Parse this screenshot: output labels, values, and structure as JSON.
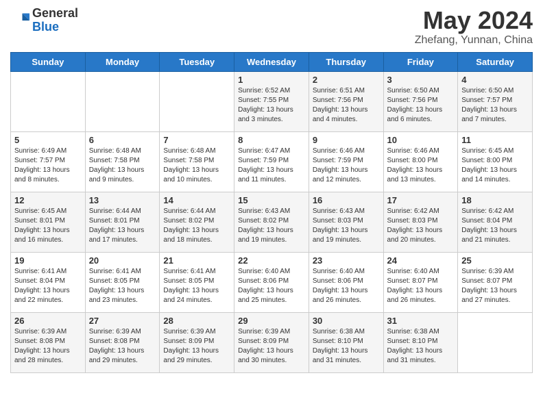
{
  "header": {
    "logo_general": "General",
    "logo_blue": "Blue",
    "title": "May 2024",
    "location": "Zhefang, Yunnan, China"
  },
  "days_of_week": [
    "Sunday",
    "Monday",
    "Tuesday",
    "Wednesday",
    "Thursday",
    "Friday",
    "Saturday"
  ],
  "weeks": [
    [
      {
        "day": "",
        "info": ""
      },
      {
        "day": "",
        "info": ""
      },
      {
        "day": "",
        "info": ""
      },
      {
        "day": "1",
        "info": "Sunrise: 6:52 AM\nSunset: 7:55 PM\nDaylight: 13 hours and 3 minutes."
      },
      {
        "day": "2",
        "info": "Sunrise: 6:51 AM\nSunset: 7:56 PM\nDaylight: 13 hours and 4 minutes."
      },
      {
        "day": "3",
        "info": "Sunrise: 6:50 AM\nSunset: 7:56 PM\nDaylight: 13 hours and 6 minutes."
      },
      {
        "day": "4",
        "info": "Sunrise: 6:50 AM\nSunset: 7:57 PM\nDaylight: 13 hours and 7 minutes."
      }
    ],
    [
      {
        "day": "5",
        "info": "Sunrise: 6:49 AM\nSunset: 7:57 PM\nDaylight: 13 hours and 8 minutes."
      },
      {
        "day": "6",
        "info": "Sunrise: 6:48 AM\nSunset: 7:58 PM\nDaylight: 13 hours and 9 minutes."
      },
      {
        "day": "7",
        "info": "Sunrise: 6:48 AM\nSunset: 7:58 PM\nDaylight: 13 hours and 10 minutes."
      },
      {
        "day": "8",
        "info": "Sunrise: 6:47 AM\nSunset: 7:59 PM\nDaylight: 13 hours and 11 minutes."
      },
      {
        "day": "9",
        "info": "Sunrise: 6:46 AM\nSunset: 7:59 PM\nDaylight: 13 hours and 12 minutes."
      },
      {
        "day": "10",
        "info": "Sunrise: 6:46 AM\nSunset: 8:00 PM\nDaylight: 13 hours and 13 minutes."
      },
      {
        "day": "11",
        "info": "Sunrise: 6:45 AM\nSunset: 8:00 PM\nDaylight: 13 hours and 14 minutes."
      }
    ],
    [
      {
        "day": "12",
        "info": "Sunrise: 6:45 AM\nSunset: 8:01 PM\nDaylight: 13 hours and 16 minutes."
      },
      {
        "day": "13",
        "info": "Sunrise: 6:44 AM\nSunset: 8:01 PM\nDaylight: 13 hours and 17 minutes."
      },
      {
        "day": "14",
        "info": "Sunrise: 6:44 AM\nSunset: 8:02 PM\nDaylight: 13 hours and 18 minutes."
      },
      {
        "day": "15",
        "info": "Sunrise: 6:43 AM\nSunset: 8:02 PM\nDaylight: 13 hours and 19 minutes."
      },
      {
        "day": "16",
        "info": "Sunrise: 6:43 AM\nSunset: 8:03 PM\nDaylight: 13 hours and 19 minutes."
      },
      {
        "day": "17",
        "info": "Sunrise: 6:42 AM\nSunset: 8:03 PM\nDaylight: 13 hours and 20 minutes."
      },
      {
        "day": "18",
        "info": "Sunrise: 6:42 AM\nSunset: 8:04 PM\nDaylight: 13 hours and 21 minutes."
      }
    ],
    [
      {
        "day": "19",
        "info": "Sunrise: 6:41 AM\nSunset: 8:04 PM\nDaylight: 13 hours and 22 minutes."
      },
      {
        "day": "20",
        "info": "Sunrise: 6:41 AM\nSunset: 8:05 PM\nDaylight: 13 hours and 23 minutes."
      },
      {
        "day": "21",
        "info": "Sunrise: 6:41 AM\nSunset: 8:05 PM\nDaylight: 13 hours and 24 minutes."
      },
      {
        "day": "22",
        "info": "Sunrise: 6:40 AM\nSunset: 8:06 PM\nDaylight: 13 hours and 25 minutes."
      },
      {
        "day": "23",
        "info": "Sunrise: 6:40 AM\nSunset: 8:06 PM\nDaylight: 13 hours and 26 minutes."
      },
      {
        "day": "24",
        "info": "Sunrise: 6:40 AM\nSunset: 8:07 PM\nDaylight: 13 hours and 26 minutes."
      },
      {
        "day": "25",
        "info": "Sunrise: 6:39 AM\nSunset: 8:07 PM\nDaylight: 13 hours and 27 minutes."
      }
    ],
    [
      {
        "day": "26",
        "info": "Sunrise: 6:39 AM\nSunset: 8:08 PM\nDaylight: 13 hours and 28 minutes."
      },
      {
        "day": "27",
        "info": "Sunrise: 6:39 AM\nSunset: 8:08 PM\nDaylight: 13 hours and 29 minutes."
      },
      {
        "day": "28",
        "info": "Sunrise: 6:39 AM\nSunset: 8:09 PM\nDaylight: 13 hours and 29 minutes."
      },
      {
        "day": "29",
        "info": "Sunrise: 6:39 AM\nSunset: 8:09 PM\nDaylight: 13 hours and 30 minutes."
      },
      {
        "day": "30",
        "info": "Sunrise: 6:38 AM\nSunset: 8:10 PM\nDaylight: 13 hours and 31 minutes."
      },
      {
        "day": "31",
        "info": "Sunrise: 6:38 AM\nSunset: 8:10 PM\nDaylight: 13 hours and 31 minutes."
      },
      {
        "day": "",
        "info": ""
      }
    ]
  ]
}
